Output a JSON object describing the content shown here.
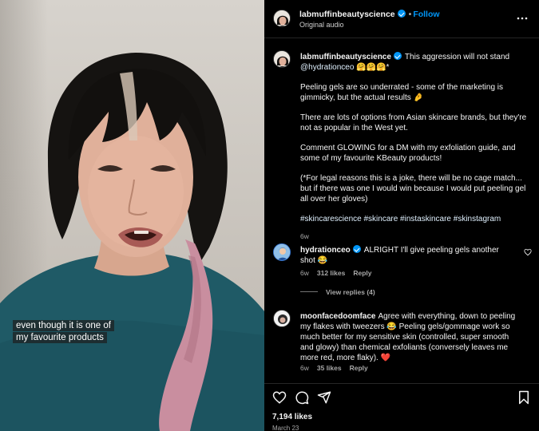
{
  "video": {
    "caption": "even though it is one of my favourite products"
  },
  "header": {
    "username": "labmuffinbeautyscience",
    "separator": "•",
    "follow_label": "Follow",
    "audio": "Original audio",
    "icons": {
      "more": "more-horizontal-icon",
      "verified": "verified-badge-icon"
    }
  },
  "post": {
    "username": "labmuffinbeautyscience",
    "line1": "This aggression will not stand",
    "mention": "@hydrationceo",
    "mention_suffix": " 🤗🤗🤗*",
    "p2": "Peeling gels are so underrated - some of the marketing is gimmicky, but the actual results 🤌",
    "p3": "There are lots of options from Asian skincare brands, but they're not as popular in the West yet.",
    "p4": "Comment GLOWING for a DM with my exfoliation guide, and some of my favourite KBeauty products!",
    "p5": "(*For legal reasons this is a joke, there will be no cage match... but if there was one I would win because I would put peeling gel all over her gloves)",
    "hashtags": "#skincarescience #skincare #instaskincare #skinstagram",
    "age": "6w"
  },
  "comments": [
    {
      "username": "hydrationceo",
      "verified": true,
      "text": "ALRIGHT I'll give peeling gels another shot 😂",
      "age": "6w",
      "likes": "312 likes",
      "reply": "Reply",
      "view_replies": "View replies (4)"
    },
    {
      "username": "moonfacedoomface",
      "verified": false,
      "text": "Agree with everything, down to peeling my flakes with tweezers 😂 Peeling gels/gommage work so much better for my sensitive skin (controlled, super smooth and glowy) than chemical exfoliants (conversely leaves me more red, more flaky). ❤️",
      "age": "6w",
      "likes": "35 likes",
      "reply": "Reply"
    }
  ],
  "footer": {
    "likes": "7,194 likes",
    "date": "March 23",
    "icons": [
      "heart-icon",
      "comment-icon",
      "share-icon",
      "bookmark-icon"
    ]
  },
  "colors": {
    "background": "#000000",
    "link": "#0095f6",
    "muted": "#a8a8a8",
    "hashtag": "#e0f1ff"
  }
}
